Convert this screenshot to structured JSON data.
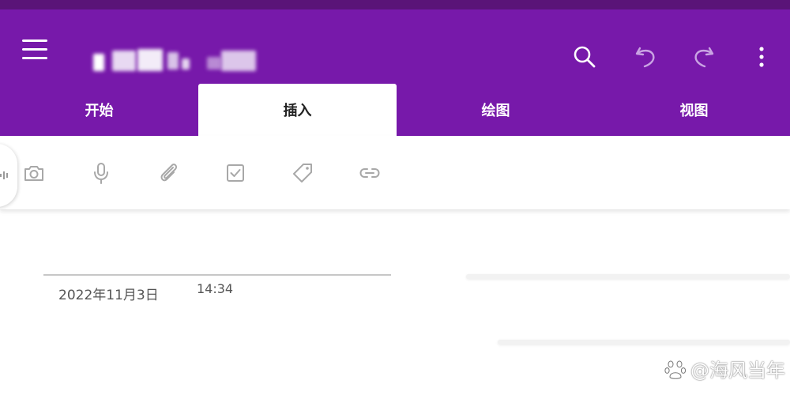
{
  "header": {
    "menu_icon": "hamburger-menu-icon",
    "search_icon": "search-icon",
    "undo_icon": "undo-icon",
    "redo_icon": "redo-icon",
    "more_icon": "more-vertical-icon",
    "accent_color": "#7719aa"
  },
  "tabs": [
    {
      "label": "开始",
      "active": false
    },
    {
      "label": "插入",
      "active": true
    },
    {
      "label": "绘图",
      "active": false
    },
    {
      "label": "视图",
      "active": false
    }
  ],
  "toolbar": {
    "icons": [
      "dictate-icon",
      "camera-icon",
      "microphone-icon",
      "attachment-icon",
      "checkbox-icon",
      "tag-icon",
      "link-icon"
    ]
  },
  "page": {
    "date": "2022年11月3日",
    "time": "14:34"
  },
  "watermark": {
    "text": "@海风当年"
  }
}
